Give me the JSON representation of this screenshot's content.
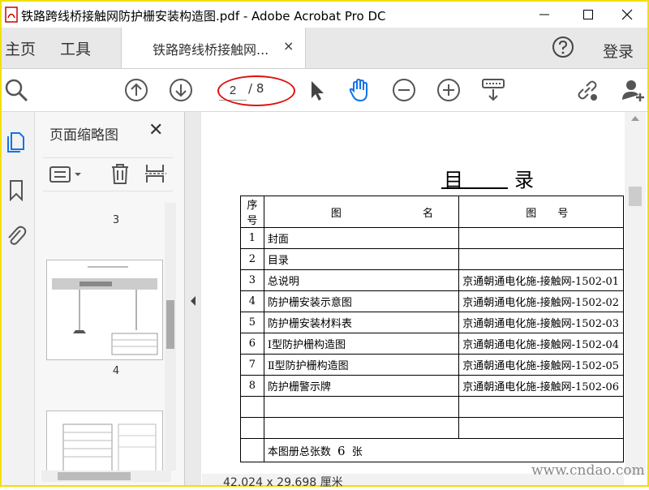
{
  "window": {
    "title": "铁路跨线桥接触网防护栅安装构造图.pdf - Adobe Acrobat Pro DC"
  },
  "menu": {
    "home": "主页",
    "tools": "工具",
    "login": "登录"
  },
  "tab": {
    "label": "铁路跨线桥接触网...",
    "close": "×"
  },
  "toolbar": {
    "page_current": "2",
    "page_total": "/ 8"
  },
  "thumbnails": {
    "title": "页面缩略图",
    "close": "✕",
    "pages": [
      {
        "num": "3"
      },
      {
        "num": "4"
      }
    ]
  },
  "document": {
    "toc_title": "目  录",
    "headers": [
      "序号",
      "图",
      "名",
      "图",
      "号"
    ],
    "rows": [
      {
        "no": "1",
        "name": "封面",
        "code": ""
      },
      {
        "no": "2",
        "name": "目录",
        "code": ""
      },
      {
        "no": "3",
        "name": "总说明",
        "code": "京通朝通电化施-接触网-1502-01"
      },
      {
        "no": "4",
        "name": "防护栅安装示意图",
        "code": "京通朝通电化施-接触网-1502-02"
      },
      {
        "no": "5",
        "name": "防护栅安装材料表",
        "code": "京通朝通电化施-接触网-1502-03"
      },
      {
        "no": "6",
        "name": "Ⅰ型防护栅构造图",
        "code": "京通朝通电化施-接触网-1502-04"
      },
      {
        "no": "7",
        "name": "Ⅱ型防护栅构造图",
        "code": "京通朝通电化施-接触网-1502-05"
      },
      {
        "no": "8",
        "name": "防护栅警示牌",
        "code": "京通朝通电化施-接触网-1502-06"
      }
    ],
    "footer_prefix": "本图册总张数",
    "footer_count": "6",
    "footer_suffix": "张"
  },
  "status": {
    "page_size": "42.024 x 29.698 厘米"
  },
  "watermark": "www.cndao.com",
  "colors": {
    "accent": "#1473e6",
    "highlight_oval": "#e01010",
    "frame": "#f0e000"
  }
}
